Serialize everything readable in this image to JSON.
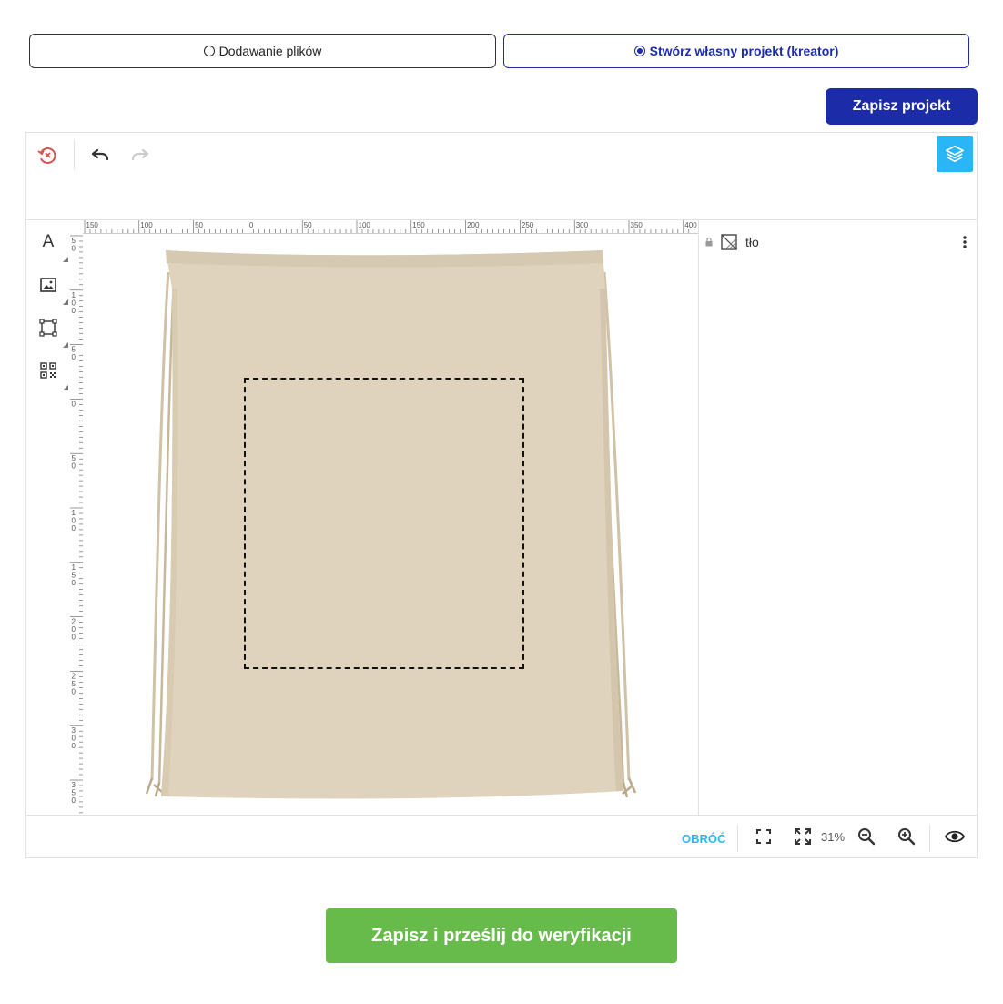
{
  "mode_tabs": {
    "upload_label": "Dodawanie plików",
    "creator_label": "Stwórz własny projekt (kreator)",
    "selected": "creator"
  },
  "save_project_label": "Zapisz projekt",
  "toolbar": {
    "icons": [
      "reset-icon",
      "undo-icon",
      "redo-icon",
      "layers-icon"
    ]
  },
  "tools": [
    "text-tool-icon",
    "image-tool-icon",
    "shape-tool-icon",
    "qr-code-tool-icon"
  ],
  "tools_text_glyph": "A",
  "ruler_top_labels": [
    "150",
    "100",
    "50",
    "0",
    "50",
    "100",
    "150",
    "200",
    "250",
    "300",
    "350",
    "400"
  ],
  "ruler_left_labels": [
    "5\n0",
    "1\n0\n0",
    "5\n0",
    "0",
    "5\n0",
    "1\n0\n0",
    "1\n5\n0",
    "2\n0\n0",
    "2\n5\n0",
    "3\n0\n0",
    "3\n5\n0"
  ],
  "layers": [
    {
      "name": "tło",
      "locked": true
    }
  ],
  "bottombar": {
    "rotate_label": "OBRÓĆ",
    "zoom_level": "31%"
  },
  "submit_label": "Zapisz i prześlij do weryfikacji",
  "colors": {
    "primary": "#1c2ba8",
    "accent": "#29b6f6",
    "success": "#66bb4a",
    "bag": "#dfd3bd"
  }
}
